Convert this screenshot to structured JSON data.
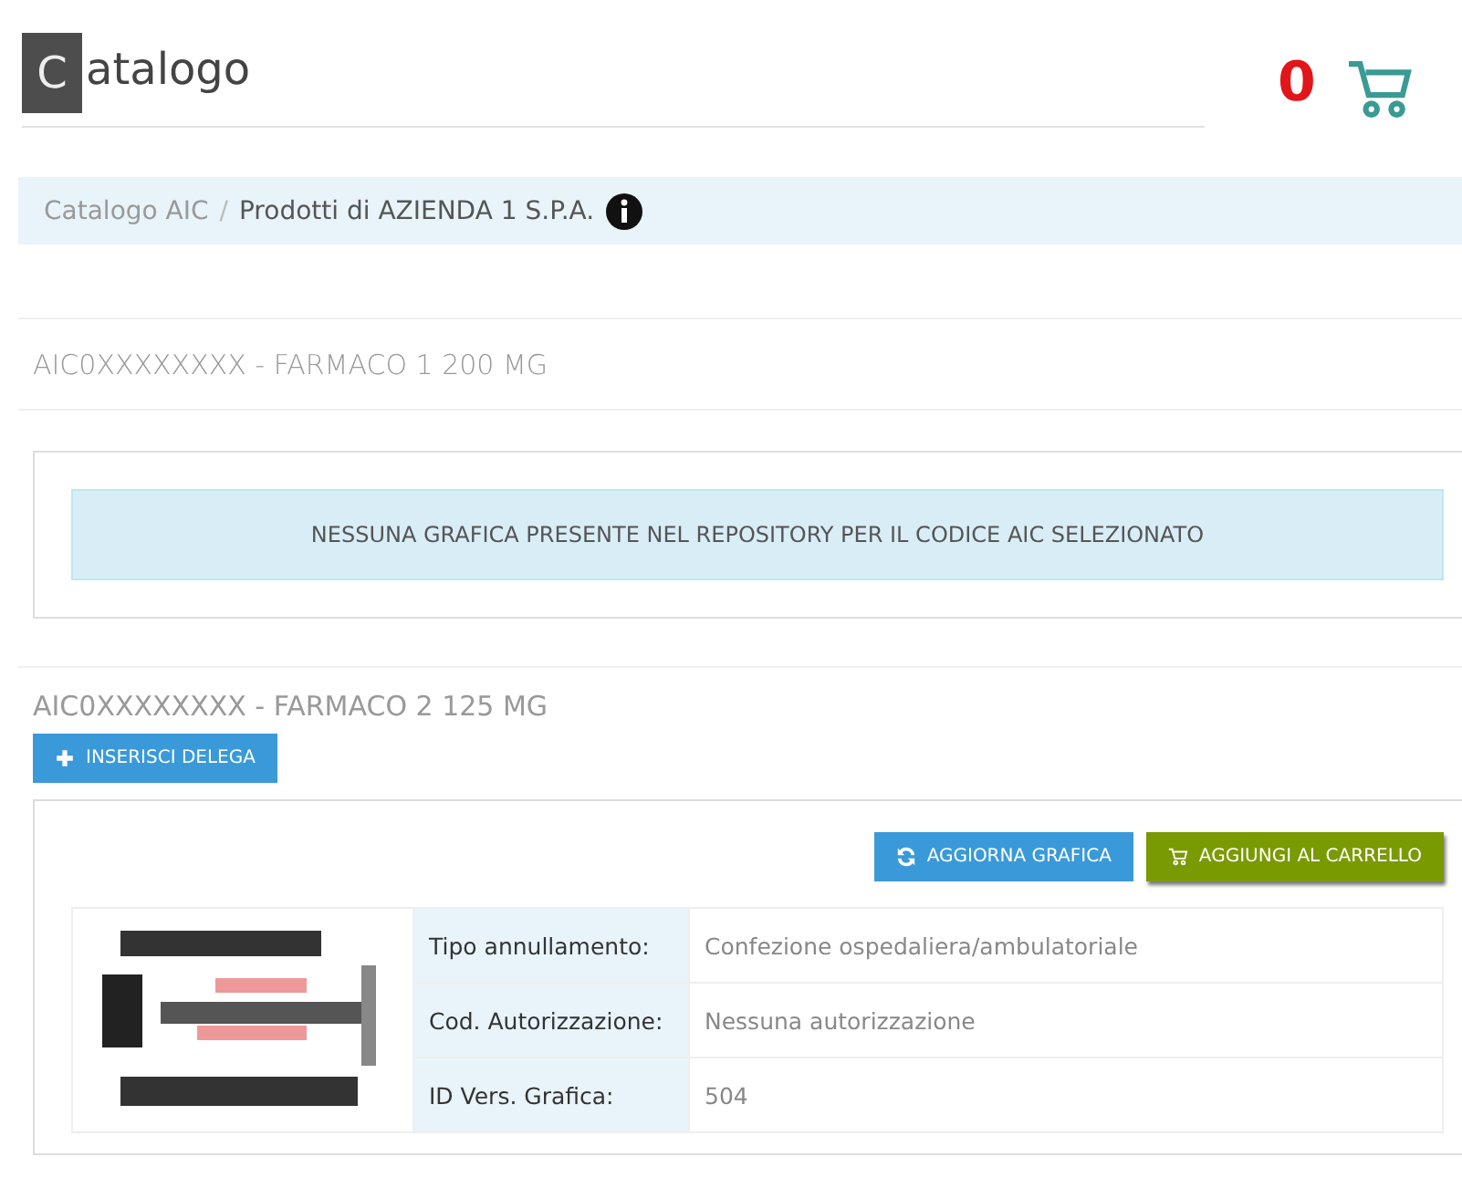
{
  "header": {
    "title_initial": "C",
    "title_rest": "atalogo",
    "cart_count": "0"
  },
  "breadcrumb_separator": "/",
  "breadcrumb": [
    {
      "label": "Catalogo AIC",
      "current": false
    },
    {
      "label": "Prodotti di AZIENDA 1 S.P.A.",
      "current": true
    }
  ],
  "products": [
    {
      "heading": "AIC0XXXXXXXX - FARMACO 1 200 MG",
      "alert": "NESSUNA GRAFICA PRESENTE NEL REPOSITORY PER IL CODICE AIC SELEZIONATO"
    },
    {
      "heading": "AIC0XXXXXXXX - FARMACO 2 125 MG",
      "delegate_button": "INSERISCI DELEGA",
      "buttons": [
        {
          "label": "AGGIORNA GRAFICA",
          "kind": "refresh"
        },
        {
          "label": "AGGIUNGI AL CARRELLO",
          "kind": "cart"
        }
      ],
      "graphic": {
        "kind": "picture"
      },
      "details": [
        {
          "label": "Tipo annullamento:",
          "value": "Confezione ospedaliera/ambulatoriale"
        },
        {
          "label": "Cod. Autorizzazione:",
          "value": "Nessuna autorizzazione"
        },
        {
          "label": "ID Vers. Grafica:",
          "value": "504"
        }
      ]
    }
  ]
}
